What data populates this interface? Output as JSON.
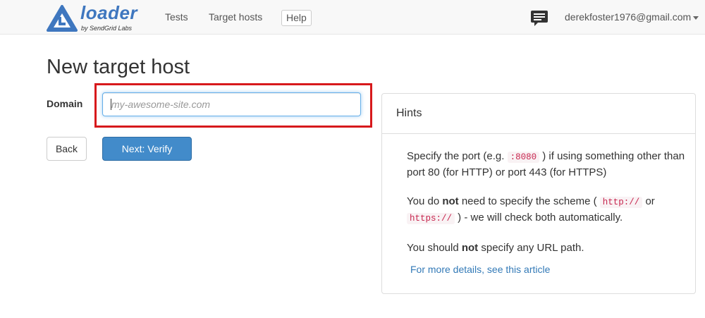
{
  "navbar": {
    "brand": "loader",
    "brand_sub": "by SendGrid Labs",
    "links": [
      "Tests",
      "Target hosts"
    ],
    "help_label": "Help",
    "chat_icon": "chat-bubble-icon",
    "user_email": "derekfoster1976@gmail.com"
  },
  "form": {
    "title": "New target host",
    "domain_label": "Domain",
    "domain_placeholder": "my-awesome-site.com",
    "domain_value": "",
    "back_label": "Back",
    "next_label": "Next: Verify"
  },
  "hints": {
    "heading": "Hints",
    "item1": {
      "prefix": "Specify the port (e.g. ",
      "code": ":8080",
      "suffix": " ) if using something other than port 80 (for HTTP) or port 443 (for HTTPS)"
    },
    "item2": {
      "prefix": "You do ",
      "bold": "not",
      "middle": " need to specify the scheme ( ",
      "code1": "http://",
      "or": " or ",
      "code2": "https://",
      "suffix": " ) - we will check both automatically."
    },
    "item3": {
      "prefix": "You should ",
      "bold": "not",
      "suffix": " specify any URL path."
    },
    "link": "For more details, see this article"
  },
  "colors": {
    "brand": "#3f77bf",
    "primary_button": "#428bca",
    "highlight": "#d7191c",
    "link": "#337ab7"
  }
}
